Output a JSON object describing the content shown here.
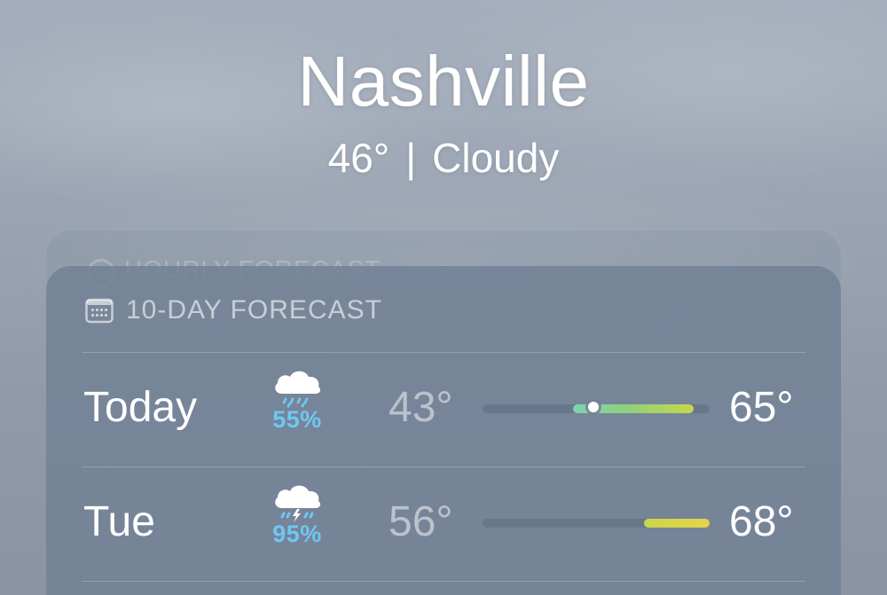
{
  "location": {
    "city": "Nashville",
    "temperature": "46°",
    "separator": "|",
    "condition": "Cloudy"
  },
  "hourly_card": {
    "title": "HOURLY FORECAST",
    "icon": "clock-icon"
  },
  "forecast": {
    "title": "10-DAY FORECAST",
    "icon": "calendar-icon",
    "range_colors": {
      "cool": "#7dd3b0",
      "mild": "#8fd17a",
      "warm": "#c8d64a",
      "hot": "#e6d44a"
    },
    "days": [
      {
        "day": "Today",
        "icon": "cloud-rain-icon",
        "precip": "55%",
        "low": "43°",
        "high": "65°",
        "range_start": 0.4,
        "range_end": 0.93,
        "current_position": 0.49
      },
      {
        "day": "Tue",
        "icon": "cloud-thunderstorm-icon",
        "precip": "95%",
        "low": "56°",
        "high": "68°",
        "range_start": 0.71,
        "range_end": 1.0
      }
    ]
  }
}
